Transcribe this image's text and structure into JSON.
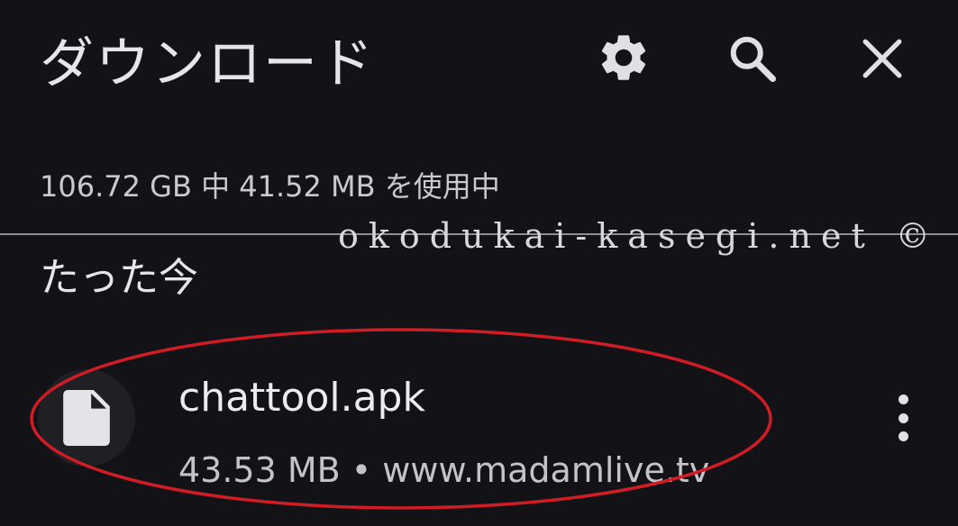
{
  "header": {
    "title": "ダウンロード",
    "icons": [
      "settings-icon",
      "search-icon",
      "close-icon"
    ]
  },
  "storage": {
    "text": "106.72 GB 中 41.52 MB を使用中"
  },
  "watermark": {
    "text": "okodukai-kasegi.net ©"
  },
  "section": {
    "label": "たった今"
  },
  "files": [
    {
      "name": "chattool.apk",
      "meta": "43.53 MB • www.madamlive.tv",
      "icon": "document-icon"
    }
  ],
  "colors": {
    "background": "#131317",
    "text": "#e6e6ea",
    "highlight": "#d01c24"
  }
}
